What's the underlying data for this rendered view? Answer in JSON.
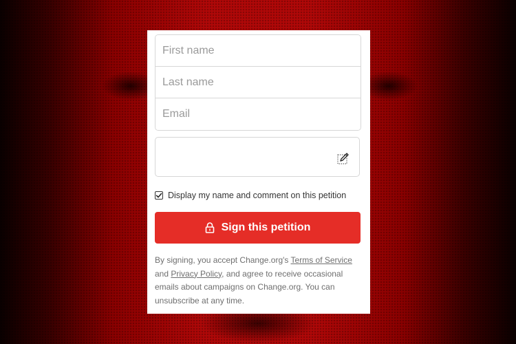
{
  "form": {
    "first_name_placeholder": "First name",
    "last_name_placeholder": "Last name",
    "email_placeholder": "Email",
    "comment_value": "",
    "display_name_checked": true,
    "display_name_label": "Display my name and comment on this petition",
    "sign_button_label": "Sign this petition"
  },
  "disclaimer": {
    "text_1": "By signing, you accept Change.org's ",
    "terms_link": "Terms of Service",
    "text_2": " and ",
    "privacy_link": "Privacy Policy",
    "text_3": ", and agree to receive occasional emails about campaigns on Change.org. You can unsubscribe at any time."
  },
  "colors": {
    "accent": "#e52d27",
    "background": "#b00808"
  },
  "icons": {
    "comment_edit": "pencil-icon",
    "checkbox": "check-icon",
    "sign_button": "lock-icon"
  }
}
